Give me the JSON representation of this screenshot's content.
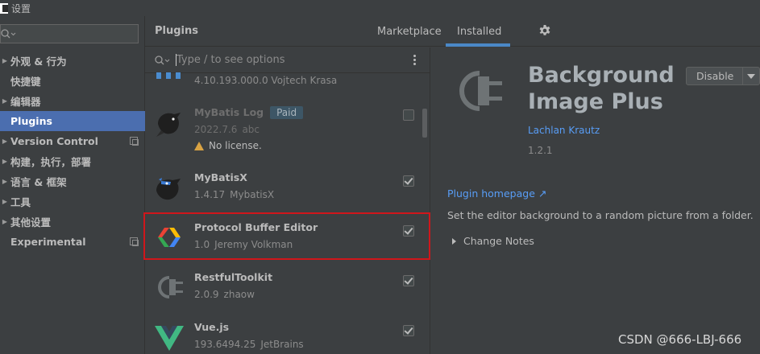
{
  "window": {
    "title": "设置"
  },
  "sidebar": {
    "search_placeholder": "",
    "items": [
      {
        "label": "外观 & 行为",
        "expandable": true
      },
      {
        "label": "快捷键",
        "expandable": false
      },
      {
        "label": "编辑器",
        "expandable": true
      },
      {
        "label": "Plugins",
        "expandable": false,
        "selected": true
      },
      {
        "label": "Version Control",
        "expandable": true,
        "copy_icon": true
      },
      {
        "label": "构建，执行，部署",
        "expandable": true
      },
      {
        "label": "语言 & 框架",
        "expandable": true
      },
      {
        "label": "工具",
        "expandable": true
      },
      {
        "label": "其他设置",
        "expandable": true
      },
      {
        "label": "Experimental",
        "expandable": false,
        "copy_icon": true
      }
    ]
  },
  "header": {
    "title": "Plugins",
    "tabs": [
      {
        "label": "Marketplace"
      },
      {
        "label": "Installed",
        "active": true
      }
    ],
    "settings_icon": "gear-icon"
  },
  "plugin_list": {
    "search_placeholder": "Type / to see options",
    "partial_top_meta": "4.10.193.000.0  Vojtech Krasa",
    "plugins": [
      {
        "name": "MyBatis Log",
        "badge": "Paid",
        "version": "2022.7.6",
        "author": "abc",
        "warning": "No license.",
        "checked": false,
        "disabled": true,
        "icon": "bird-icon"
      },
      {
        "name": "MyBatisX",
        "version": "1.4.17",
        "author": "MybatisX",
        "checked": true,
        "icon": "bird-icon"
      },
      {
        "name": "Protocol Buffer Editor",
        "version": "1.0",
        "author": "Jeremy Volkman",
        "checked": true,
        "icon": "protobuf-icon",
        "highlighted": true
      },
      {
        "name": "RestfulToolkit",
        "version": "2.0.9",
        "author": "zhaow",
        "checked": true,
        "icon": "plug-icon"
      },
      {
        "name": "Vue.js",
        "version": "193.6494.25",
        "author": "JetBrains",
        "checked": true,
        "icon": "vue-icon"
      }
    ]
  },
  "detail": {
    "name": "Background Image Plus",
    "name_line1": "Background",
    "name_line2": "Image Plus",
    "disable_label": "Disable",
    "vendor": "Lachlan Krautz",
    "version": "1.2.1",
    "homepage_label": "Plugin homepage ↗",
    "description": "Set the editor background to a random picture from a folder.",
    "change_notes_label": "Change Notes"
  },
  "watermark": "CSDN @666-LBJ-666",
  "colors": {
    "selection": "#4b6eaf",
    "link": "#589df6",
    "highlight_border": "#d0161b",
    "tab_underline": "#4a88c7"
  }
}
